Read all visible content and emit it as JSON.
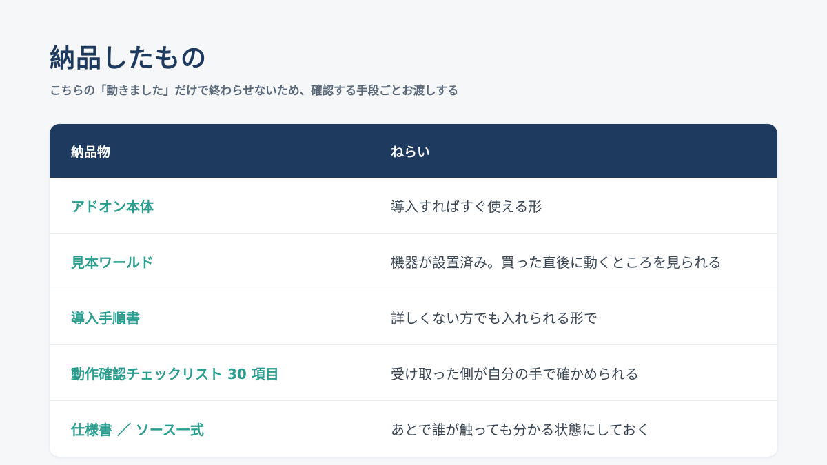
{
  "header": {
    "title": "納品したもの",
    "subtitle": "こちらの「動きました」だけで終わらせないため、確認する手段ごとお渡しする"
  },
  "table": {
    "columns": [
      "納品物",
      "ねらい"
    ],
    "rows": [
      {
        "item": "アドオン本体",
        "aim": "導入すればすぐ使える形"
      },
      {
        "item": "見本ワールド",
        "aim": "機器が設置済み。買った直後に動くところを見られる"
      },
      {
        "item": "導入手順書",
        "aim": "詳しくない方でも入れられる形で"
      },
      {
        "item": "動作確認チェックリスト 30 項目",
        "aim": "受け取った側が自分の手で確かめられる"
      },
      {
        "item": "仕様書 ／ ソース一式",
        "aim": "あとで誰が触っても分かる状態にしておく"
      }
    ]
  },
  "colors": {
    "accent": "#2a9d8f",
    "header_bg": "#1f3a5f",
    "title": "#1f3a5f",
    "background": "#f5f7f9"
  }
}
